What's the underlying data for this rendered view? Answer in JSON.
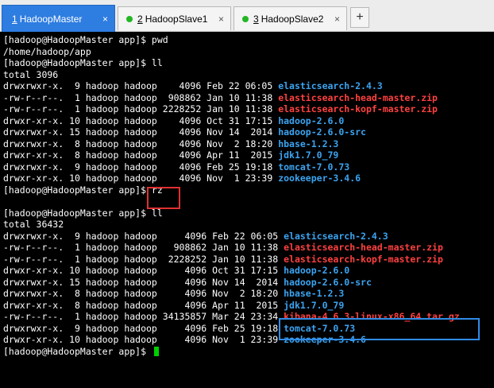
{
  "tabs": [
    {
      "index": "1",
      "label": "HadoopMaster",
      "active": true
    },
    {
      "index": "2",
      "label": "HadoopSlave1",
      "active": false,
      "status_color": "#22b722"
    },
    {
      "index": "3",
      "label": "HadoopSlave2",
      "active": false,
      "status_color": "#22b722"
    }
  ],
  "new_tab_label": "+",
  "close_glyph": "×",
  "colors": {
    "dir": "#3ba3f0",
    "zip": "#ff4040",
    "text": "#ffffff",
    "cursor": "#00d000",
    "highlight_red": "#e03030",
    "highlight_blue": "#2f8ce6"
  },
  "terminal_lines": [
    {
      "text": "[hadoop@HadoopMaster app]$ pwd",
      "name": ""
    },
    {
      "text": "/home/hadoop/app",
      "name": ""
    },
    {
      "text": "[hadoop@HadoopMaster app]$ ll",
      "name": ""
    },
    {
      "text": "total 3096",
      "name": ""
    },
    {
      "text": "drwxrwxr-x.  9 hadoop hadoop    4096 Feb 22 06:05 ",
      "name": "elasticsearch-2.4.3",
      "kind": "dir"
    },
    {
      "text": "-rw-r--r--.  1 hadoop hadoop  908862 Jan 10 11:38 ",
      "name": "elasticsearch-head-master.zip",
      "kind": "zip"
    },
    {
      "text": "-rw-r--r--.  1 hadoop hadoop 2228252 Jan 10 11:38 ",
      "name": "elasticsearch-kopf-master.zip",
      "kind": "zip"
    },
    {
      "text": "drwxr-xr-x. 10 hadoop hadoop    4096 Oct 31 17:15 ",
      "name": "hadoop-2.6.0",
      "kind": "dir"
    },
    {
      "text": "drwxrwxr-x. 15 hadoop hadoop    4096 Nov 14  2014 ",
      "name": "hadoop-2.6.0-src",
      "kind": "dir"
    },
    {
      "text": "drwxrwxr-x.  8 hadoop hadoop    4096 Nov  2 18:20 ",
      "name": "hbase-1.2.3",
      "kind": "dir"
    },
    {
      "text": "drwxr-xr-x.  8 hadoop hadoop    4096 Apr 11  2015 ",
      "name": "jdk1.7.0_79",
      "kind": "dir"
    },
    {
      "text": "drwxrwxr-x.  9 hadoop hadoop    4096 Feb 25 19:18 ",
      "name": "tomcat-7.0.73",
      "kind": "dir"
    },
    {
      "text": "drwxr-xr-x. 10 hadoop hadoop    4096 Nov  1 23:39 ",
      "name": "zookeeper-3.4.6",
      "kind": "dir"
    },
    {
      "text": "[hadoop@HadoopMaster app]$ rz",
      "name": ""
    },
    {
      "text": "",
      "name": ""
    },
    {
      "text": "[hadoop@HadoopMaster app]$ ll",
      "name": ""
    },
    {
      "text": "total 36432",
      "name": ""
    },
    {
      "text": "drwxrwxr-x.  9 hadoop hadoop     4096 Feb 22 06:05 ",
      "name": "elasticsearch-2.4.3",
      "kind": "dir"
    },
    {
      "text": "-rw-r--r--.  1 hadoop hadoop   908862 Jan 10 11:38 ",
      "name": "elasticsearch-head-master.zip",
      "kind": "zip"
    },
    {
      "text": "-rw-r--r--.  1 hadoop hadoop  2228252 Jan 10 11:38 ",
      "name": "elasticsearch-kopf-master.zip",
      "kind": "zip"
    },
    {
      "text": "drwxr-xr-x. 10 hadoop hadoop     4096 Oct 31 17:15 ",
      "name": "hadoop-2.6.0",
      "kind": "dir"
    },
    {
      "text": "drwxrwxr-x. 15 hadoop hadoop     4096 Nov 14  2014 ",
      "name": "hadoop-2.6.0-src",
      "kind": "dir"
    },
    {
      "text": "drwxrwxr-x.  8 hadoop hadoop     4096 Nov  2 18:20 ",
      "name": "hbase-1.2.3",
      "kind": "dir"
    },
    {
      "text": "drwxr-xr-x.  8 hadoop hadoop     4096 Apr 11  2015 ",
      "name": "jdk1.7.0_79",
      "kind": "dir"
    },
    {
      "text": "-rw-r--r--.  1 hadoop hadoop 34135857 Mar 24 23:34 ",
      "name": "kibana-4.6.3-linux-x86_64.tar.gz",
      "kind": "zip"
    },
    {
      "text": "drwxrwxr-x.  9 hadoop hadoop     4096 Feb 25 19:18 ",
      "name": "tomcat-7.0.73",
      "kind": "dir"
    },
    {
      "text": "drwxr-xr-x. 10 hadoop hadoop     4096 Nov  1 23:39 ",
      "name": "zookeeper-3.4.6",
      "kind": "dir"
    },
    {
      "text": "[hadoop@HadoopMaster app]$ ",
      "name": "",
      "cursor": true
    }
  ]
}
